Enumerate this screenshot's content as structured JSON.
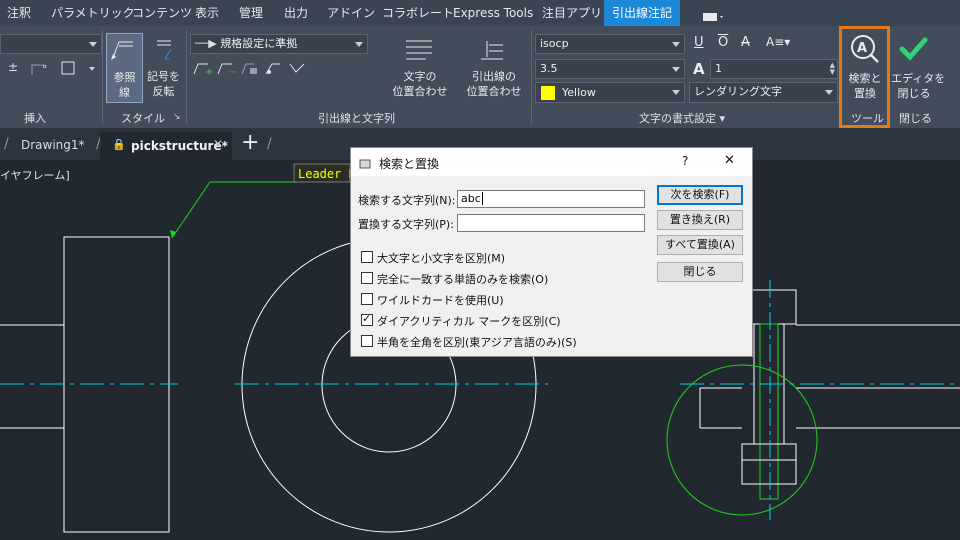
{
  "menu": {
    "items": [
      "注釈",
      "パラメトリック",
      "コンテンツ",
      "表示",
      "管理",
      "出力",
      "アドイン",
      "コラボレート",
      "Express Tools",
      "注目アプリ",
      "引出線注記"
    ],
    "active_index": 10
  },
  "ribbon": {
    "insert_panel": {
      "label": "挿入"
    },
    "style_panel": {
      "label": "スタイル",
      "reference_line_btn": [
        "参照",
        "線"
      ],
      "flip_symbol_btn": [
        "記号を",
        "反転"
      ]
    },
    "leader_panel": {
      "label": "引出線と文字列",
      "standard_combo": "規格設定に準拠",
      "text_align_btn": [
        "文字の",
        "位置合わせ"
      ],
      "leader_align_btn": [
        "引出線の",
        "位置合わせ"
      ]
    },
    "text_format_panel": {
      "label": "文字の書式設定",
      "font_combo": "isocp",
      "height_combo": "3.5",
      "color_combo": "Yellow",
      "color_swatch": "#ffff00",
      "width_value": "1",
      "render_combo": "レンダリング文字"
    },
    "tools_panel": {
      "label": "ツール",
      "find_replace_btn": [
        "検索と",
        "置換"
      ]
    },
    "close_panel": {
      "label": "閉じる",
      "close_editor_btn": [
        "エディタを",
        "閉じる"
      ]
    }
  },
  "tabs": {
    "items": [
      "Drawing1*",
      "pickstructure*"
    ],
    "viewport_label": "イヤフレーム]"
  },
  "drawing": {
    "leader_text": "Leader N"
  },
  "dialog": {
    "title": "検索と置換",
    "help": "?",
    "close": "✕",
    "find_label": "検索する文字列(N):",
    "find_value": "abc",
    "replace_label": "置換する文字列(P):",
    "replace_value": "",
    "buttons": {
      "find_next": "次を検索(F)",
      "replace": "置き換え(R)",
      "replace_all": "すべて置換(A)",
      "close": "閉じる"
    },
    "options": [
      {
        "label": "大文字と小文字を区別(M)",
        "checked": false
      },
      {
        "label": "完全に一致する単語のみを検索(O)",
        "checked": false
      },
      {
        "label": "ワイルドカードを使用(U)",
        "checked": false
      },
      {
        "label": "ダイアクリティカル マークを区別(C)",
        "checked": true
      },
      {
        "label": "半角を全角を区別(東アジア言語のみ)(S)",
        "checked": false
      }
    ]
  },
  "colors": {
    "accent_blue": "#1e88d8",
    "highlight_orange": "#e07b1a",
    "cad_cyan": "#00d2e6",
    "cad_green": "#1fd21f"
  }
}
